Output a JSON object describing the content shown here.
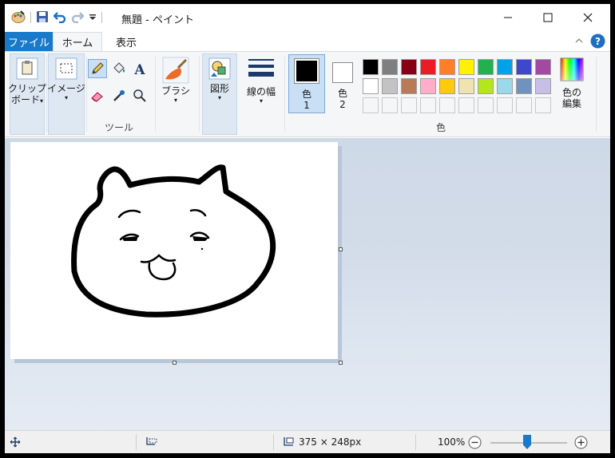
{
  "window": {
    "title": "無題 - ペイント",
    "minimize_icon": "minimize-icon",
    "maximize_icon": "maximize-icon",
    "close_icon": "close-icon"
  },
  "tabs": [
    {
      "label": "ファイル"
    },
    {
      "label": "ホーム"
    },
    {
      "label": "表示"
    }
  ],
  "ribbon": {
    "clipboard": {
      "label_line1": "クリップ",
      "label_line2": "ボード"
    },
    "image": {
      "label": "イメージ"
    },
    "tools": {
      "group_label": "ツール"
    },
    "brush": {
      "label": "ブラシ"
    },
    "shapes": {
      "label": "図形"
    },
    "size": {
      "label": "線の幅"
    },
    "color1": {
      "label_line1": "色",
      "label_line2": "1",
      "value": "#000000"
    },
    "color2": {
      "label_line1": "色",
      "label_line2": "2",
      "value": "#ffffff"
    },
    "colors_group_label": "色",
    "edit_colors": {
      "label_line1": "色の",
      "label_line2": "編集"
    },
    "palette_row1": [
      "#000000",
      "#7f7f7f",
      "#880015",
      "#ed1c24",
      "#ff7f27",
      "#fff200",
      "#22b14c",
      "#00a2e8",
      "#3f48cc",
      "#a349a4"
    ],
    "palette_row2": [
      "#ffffff",
      "#c3c3c3",
      "#b97a57",
      "#ffaec9",
      "#ffc90e",
      "#efe4b0",
      "#b5e61d",
      "#99d9ea",
      "#7092be",
      "#c8bfe7"
    ]
  },
  "status": {
    "canvas_size": "375 × 248px",
    "zoom": "100%"
  },
  "accent": "#1979ca"
}
